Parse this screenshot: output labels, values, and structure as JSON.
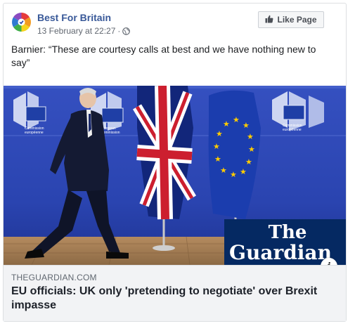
{
  "post": {
    "page_name": "Best For Britain",
    "timestamp": "13 February at 22:27",
    "separator": "·",
    "audience_icon": "globe-icon",
    "like_button_label": "Like Page",
    "like_icon": "thumbs-up-icon",
    "text": "Barnier: “These are courtesy calls at best and we have nothing new to say”"
  },
  "link": {
    "domain": "THEGUARDIAN.COM",
    "headline": "EU officials: UK only 'pretending to negotiate' over Brexit impasse",
    "info_label": "i",
    "image": {
      "logo_line1": "The",
      "logo_line2": "Guardian",
      "banner_line1": "Commission",
      "banner_line2": "européenne",
      "banner_line3": "European",
      "banner_line4": "Commission"
    }
  },
  "colors": {
    "link_blue": "#385898",
    "guardian_navy": "#052962",
    "eu_blue": "#1f3fa6",
    "eu_star": "#ffcc00"
  }
}
